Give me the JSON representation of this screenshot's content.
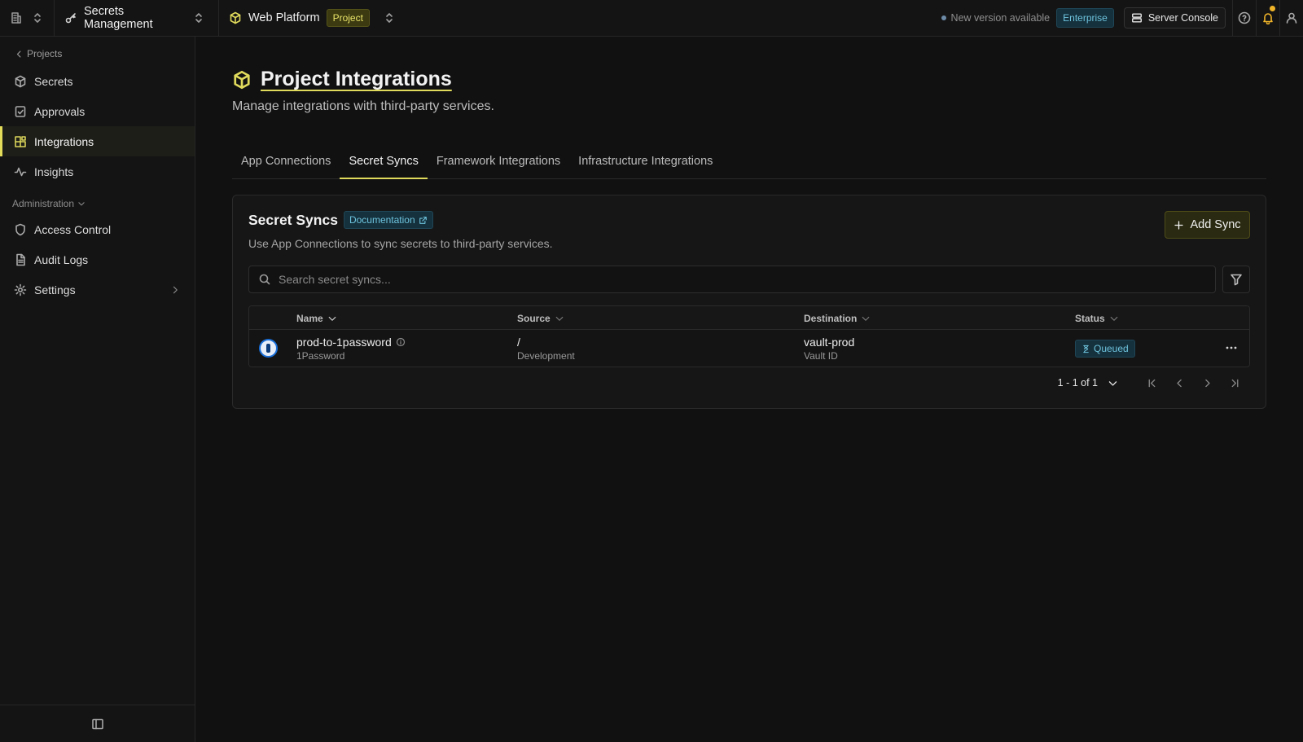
{
  "topbar": {
    "product": "Secrets Management",
    "project_name": "Web Platform",
    "project_badge": "Project",
    "new_version": "New version available",
    "plan_badge": "Enterprise",
    "server_console": "Server Console"
  },
  "sidebar": {
    "back_label": "Projects",
    "items": [
      {
        "label": "Secrets",
        "icon": "box-icon"
      },
      {
        "label": "Approvals",
        "icon": "check-square-icon"
      },
      {
        "label": "Integrations",
        "icon": "puzzle-icon",
        "active": true
      },
      {
        "label": "Insights",
        "icon": "activity-icon"
      }
    ],
    "admin_header": "Administration",
    "admin_items": [
      {
        "label": "Access Control",
        "icon": "shield-icon"
      },
      {
        "label": "Audit Logs",
        "icon": "file-icon"
      },
      {
        "label": "Settings",
        "icon": "gear-icon"
      }
    ]
  },
  "main": {
    "title": "Project Integrations",
    "subtitle": "Manage integrations with third-party services.",
    "tabs": [
      {
        "label": "App Connections"
      },
      {
        "label": "Secret Syncs",
        "active": true
      },
      {
        "label": "Framework Integrations"
      },
      {
        "label": "Infrastructure Integrations"
      }
    ]
  },
  "card": {
    "title": "Secret Syncs",
    "doc_badge": "Documentation",
    "description": "Use App Connections to sync secrets to third-party services.",
    "add_button": "Add Sync",
    "search_placeholder": "Search secret syncs..."
  },
  "table": {
    "columns": [
      "Name",
      "Source",
      "Destination",
      "Status"
    ],
    "rows": [
      {
        "name": "prod-to-1password",
        "service": "1Password",
        "source_path": "/",
        "source_env": "Development",
        "destination": "vault-prod",
        "destination_sub": "Vault ID",
        "status": "Queued"
      }
    ]
  },
  "pagination": {
    "range": "1 - 1 of 1"
  },
  "colors": {
    "accent": "#e0da5c",
    "info_badge": "#6ec3dd",
    "notification": "#f0b429"
  }
}
